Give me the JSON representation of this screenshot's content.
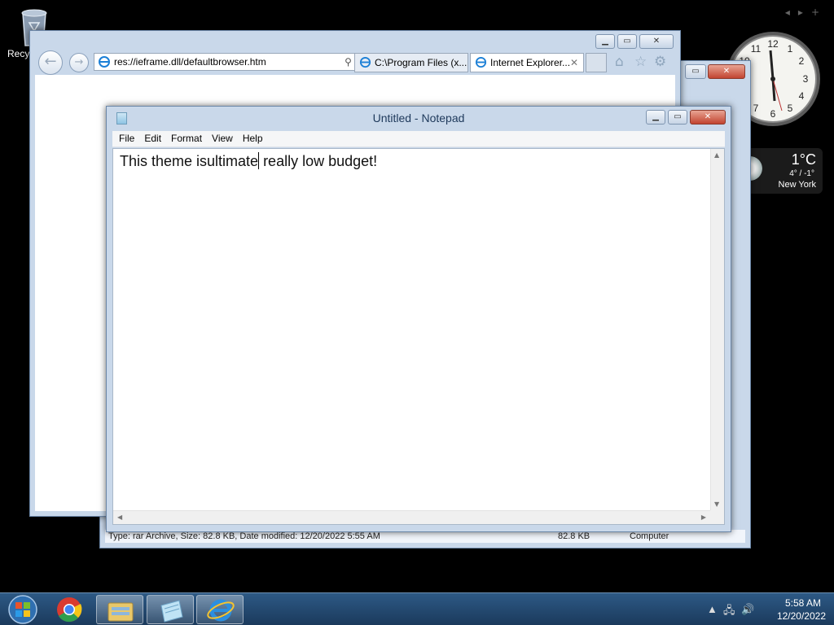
{
  "desktop": {
    "recycle_bin_label": "Recyc"
  },
  "weather": {
    "temp": "1°C",
    "range": "4° / -1°",
    "city": "New York"
  },
  "explorer": {
    "status_text": "Type: rar Archive, Size: 82.8 KB, Date modified: 12/20/2022 5:55 AM",
    "status_size": "82.8 KB",
    "status_location": "Computer"
  },
  "ie": {
    "address": "res://ieframe.dll/defaultbrowser.htm",
    "tabs": [
      {
        "label": "C:\\Program Files (x..."
      },
      {
        "label": "Internet Explorer..."
      }
    ]
  },
  "notepad": {
    "title": "Untitled - Notepad",
    "menu": [
      "File",
      "Edit",
      "Format",
      "View",
      "Help"
    ],
    "text_before_caret": "This theme isultimate",
    "text_after_caret": " really low budget!"
  },
  "taskbar": {
    "time": "5:58 AM",
    "date": "12/20/2022"
  }
}
